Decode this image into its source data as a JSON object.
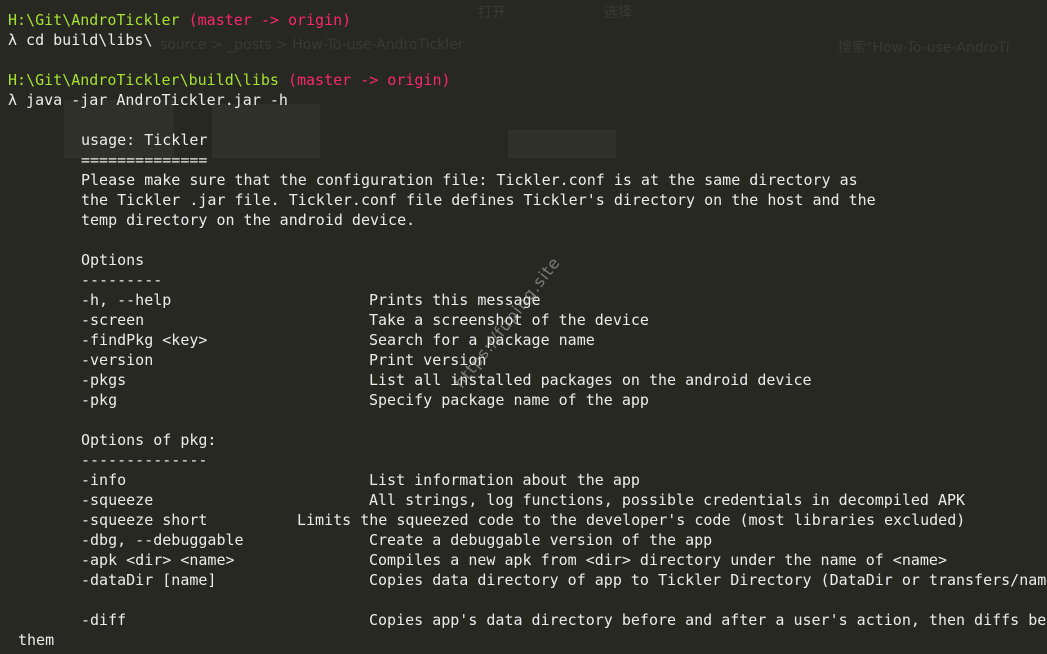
{
  "background_window": {
    "menu_left": "打开",
    "menu_right": "选择",
    "breadcrumb": "source  >  _posts  >  How-To-use-AndroTickler",
    "search": "搜索\"How-To-use-AndroTi"
  },
  "prompt1": {
    "path": "H:\\Git\\AndroTickler",
    "branch": " (master -> origin)"
  },
  "cmd1": "λ cd build\\libs\\",
  "prompt2": {
    "path": "H:\\Git\\AndroTickler\\build\\libs",
    "branch": " (master -> origin)"
  },
  "cmd2": "λ java -jar AndroTickler.jar -h",
  "usage": {
    "title": "usage: Tickler",
    "underline": "==============",
    "desc": [
      "Please make sure that the configuration file: Tickler.conf is at the same directory as",
      "the Tickler .jar file. Tickler.conf file defines Tickler's directory on the host and the",
      "temp directory on the android device."
    ]
  },
  "options": {
    "heading": "Options",
    "underline": "---------",
    "items": [
      {
        "flag": "-h, --help",
        "desc": "Prints this message"
      },
      {
        "flag": "-screen",
        "desc": "Take a screenshot of the device"
      },
      {
        "flag": "-findPkg <key>",
        "desc": "Search for a package name"
      },
      {
        "flag": "-version",
        "desc": "Print version"
      },
      {
        "flag": "-pkgs",
        "desc": "List all installed packages on the android device"
      },
      {
        "flag": "-pkg",
        "desc": "Specify package name of the app"
      }
    ]
  },
  "pkg_options": {
    "heading": "Options of pkg:",
    "underline": "--------------",
    "items": [
      {
        "flag": "-info",
        "desc": "List information about the app"
      },
      {
        "flag": "-squeeze",
        "desc": "All strings, log functions, possible credentials in decompiled APK"
      },
      {
        "flag": "-squeeze short",
        "desc": "Limits the squeezed code to the developer's code (most libraries excluded)"
      },
      {
        "flag": "-dbg, --debuggable",
        "desc": "Create a debuggable version of the app"
      },
      {
        "flag": "-apk <dir> <name>",
        "desc": "Compiles a new apk from <dir> directory under the name of <name>"
      },
      {
        "flag": "-dataDir [name]",
        "desc": "Copies data directory of app to Tickler Directory (DataDir or transfers/name"
      }
    ]
  },
  "diff": {
    "flag": "-diff",
    "desc": "Copies app's data directory before and after a user's action, then diffs bet",
    "wrap": "them"
  },
  "watermark": "https://fuping.site",
  "colors": {
    "background": "#272822",
    "path": "#a6e22e",
    "branch": "#f92672",
    "text": "#ececec"
  }
}
